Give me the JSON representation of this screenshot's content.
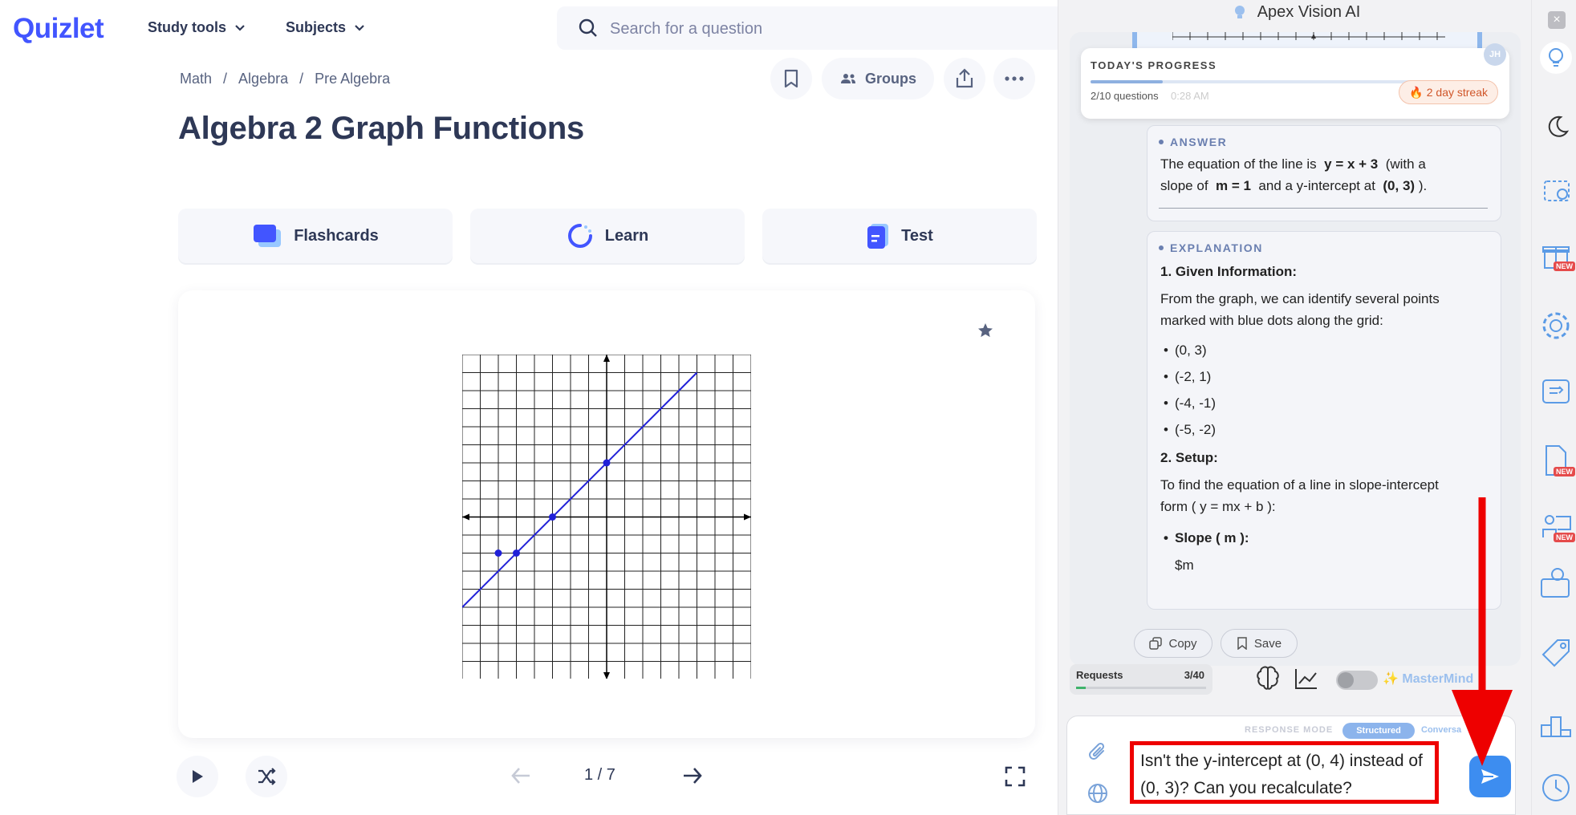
{
  "quizlet": {
    "logo": "Quizlet",
    "nav": {
      "study_tools": "Study tools",
      "subjects": "Subjects"
    },
    "search_placeholder": "Search for a question",
    "breadcrumb": [
      "Math",
      "Algebra",
      "Pre Algebra"
    ],
    "title": "Algebra 2 Graph Functions",
    "groups_label": "Groups",
    "modes": {
      "flashcards": "Flashcards",
      "learn": "Learn",
      "test": "Test"
    },
    "pager": "1 / 7",
    "brand_color": "#4255ff"
  },
  "panel": {
    "title": "Apex Vision AI",
    "progress": {
      "label": "TODAY'S PROGRESS",
      "questions": "2/10 questions",
      "time": "0:28 AM",
      "streak": "2 day streak",
      "fraction": 0.2
    },
    "answer": {
      "heading": "ANSWER",
      "line1_pre": "The equation of the line is",
      "equation": "y = x + 3",
      "line1_post": "(with a",
      "line2_pre": "slope of",
      "slope": "m = 1",
      "line2_mid": "and a y-intercept at",
      "intercept": "(0, 3)",
      "line2_post": ")."
    },
    "explanation": {
      "heading": "EXPLANATION",
      "given_title": "1. Given Information:",
      "given_text_1": "From the graph, we can identify several points",
      "given_text_2": "marked with blue dots along the grid:",
      "points": [
        "(0, 3)",
        "(-2, 1)",
        "(-4, -1)",
        "(-5, -2)"
      ],
      "setup_title": "2. Setup:",
      "setup_text_1": "To find the equation of a line in slope-intercept",
      "setup_text_2": "form ( y = mx + b ):",
      "slope_bullet": "Slope ( m ):",
      "slope_value": "$m"
    },
    "copy_label": "Copy",
    "save_label": "Save",
    "requests": {
      "label": "Requests",
      "count": "3/40",
      "fraction": 0.075
    },
    "mastermind_label": "MasterMind",
    "response_mode": {
      "label": "RESPONSE MODE",
      "structured": "Structured",
      "conversational": "Conversa"
    },
    "message": "Isn't the y-intercept at (0, 4) instead of (0, 3)? Can you recalculate?",
    "avatar_initials": "JH"
  },
  "rail": {
    "new_badge": "NEW",
    "close": "×"
  },
  "colors": {
    "accent_blue": "#3d8df0",
    "highlight_red": "#ee0000",
    "dot_blue": "#2020d8"
  }
}
